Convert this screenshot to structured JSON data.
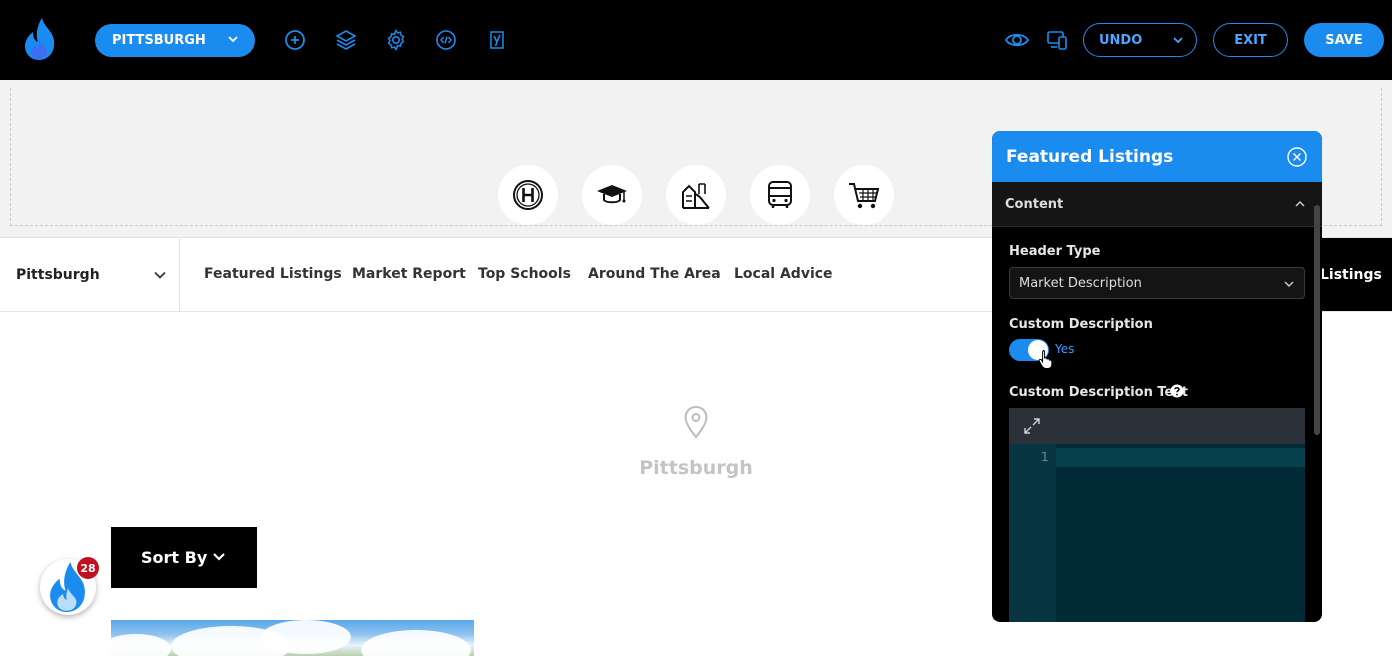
{
  "toolbar": {
    "location_label": "PITTSBURGH",
    "undo_label": "UNDO",
    "exit_label": "EXIT",
    "save_label": "SAVE",
    "icons": [
      "add-icon",
      "layers-icon",
      "gear-icon",
      "code-icon",
      "yoast-icon",
      "eye-icon",
      "responsive-icon"
    ],
    "accent": "#1a8cf0"
  },
  "amenities": [
    "hospital-icon",
    "school-icon",
    "playground-icon",
    "bus-icon",
    "shopping-cart-icon"
  ],
  "nav": {
    "city": "Pittsburgh",
    "links": [
      "Featured Listings",
      "Market Report",
      "Top Schools",
      "Around The Area",
      "Local Advice"
    ],
    "overflow_label": "Listings"
  },
  "main": {
    "city_label": "Pittsburgh",
    "sort_label": "Sort By"
  },
  "notification": {
    "count": "28"
  },
  "panel": {
    "title": "Featured Listings",
    "section": "Content",
    "header_type_label": "Header Type",
    "header_type_value": "Market Description",
    "custom_description_label": "Custom Description",
    "toggle_label": "Yes",
    "custom_text_label": "Custom Description Text",
    "line_number": "1"
  }
}
